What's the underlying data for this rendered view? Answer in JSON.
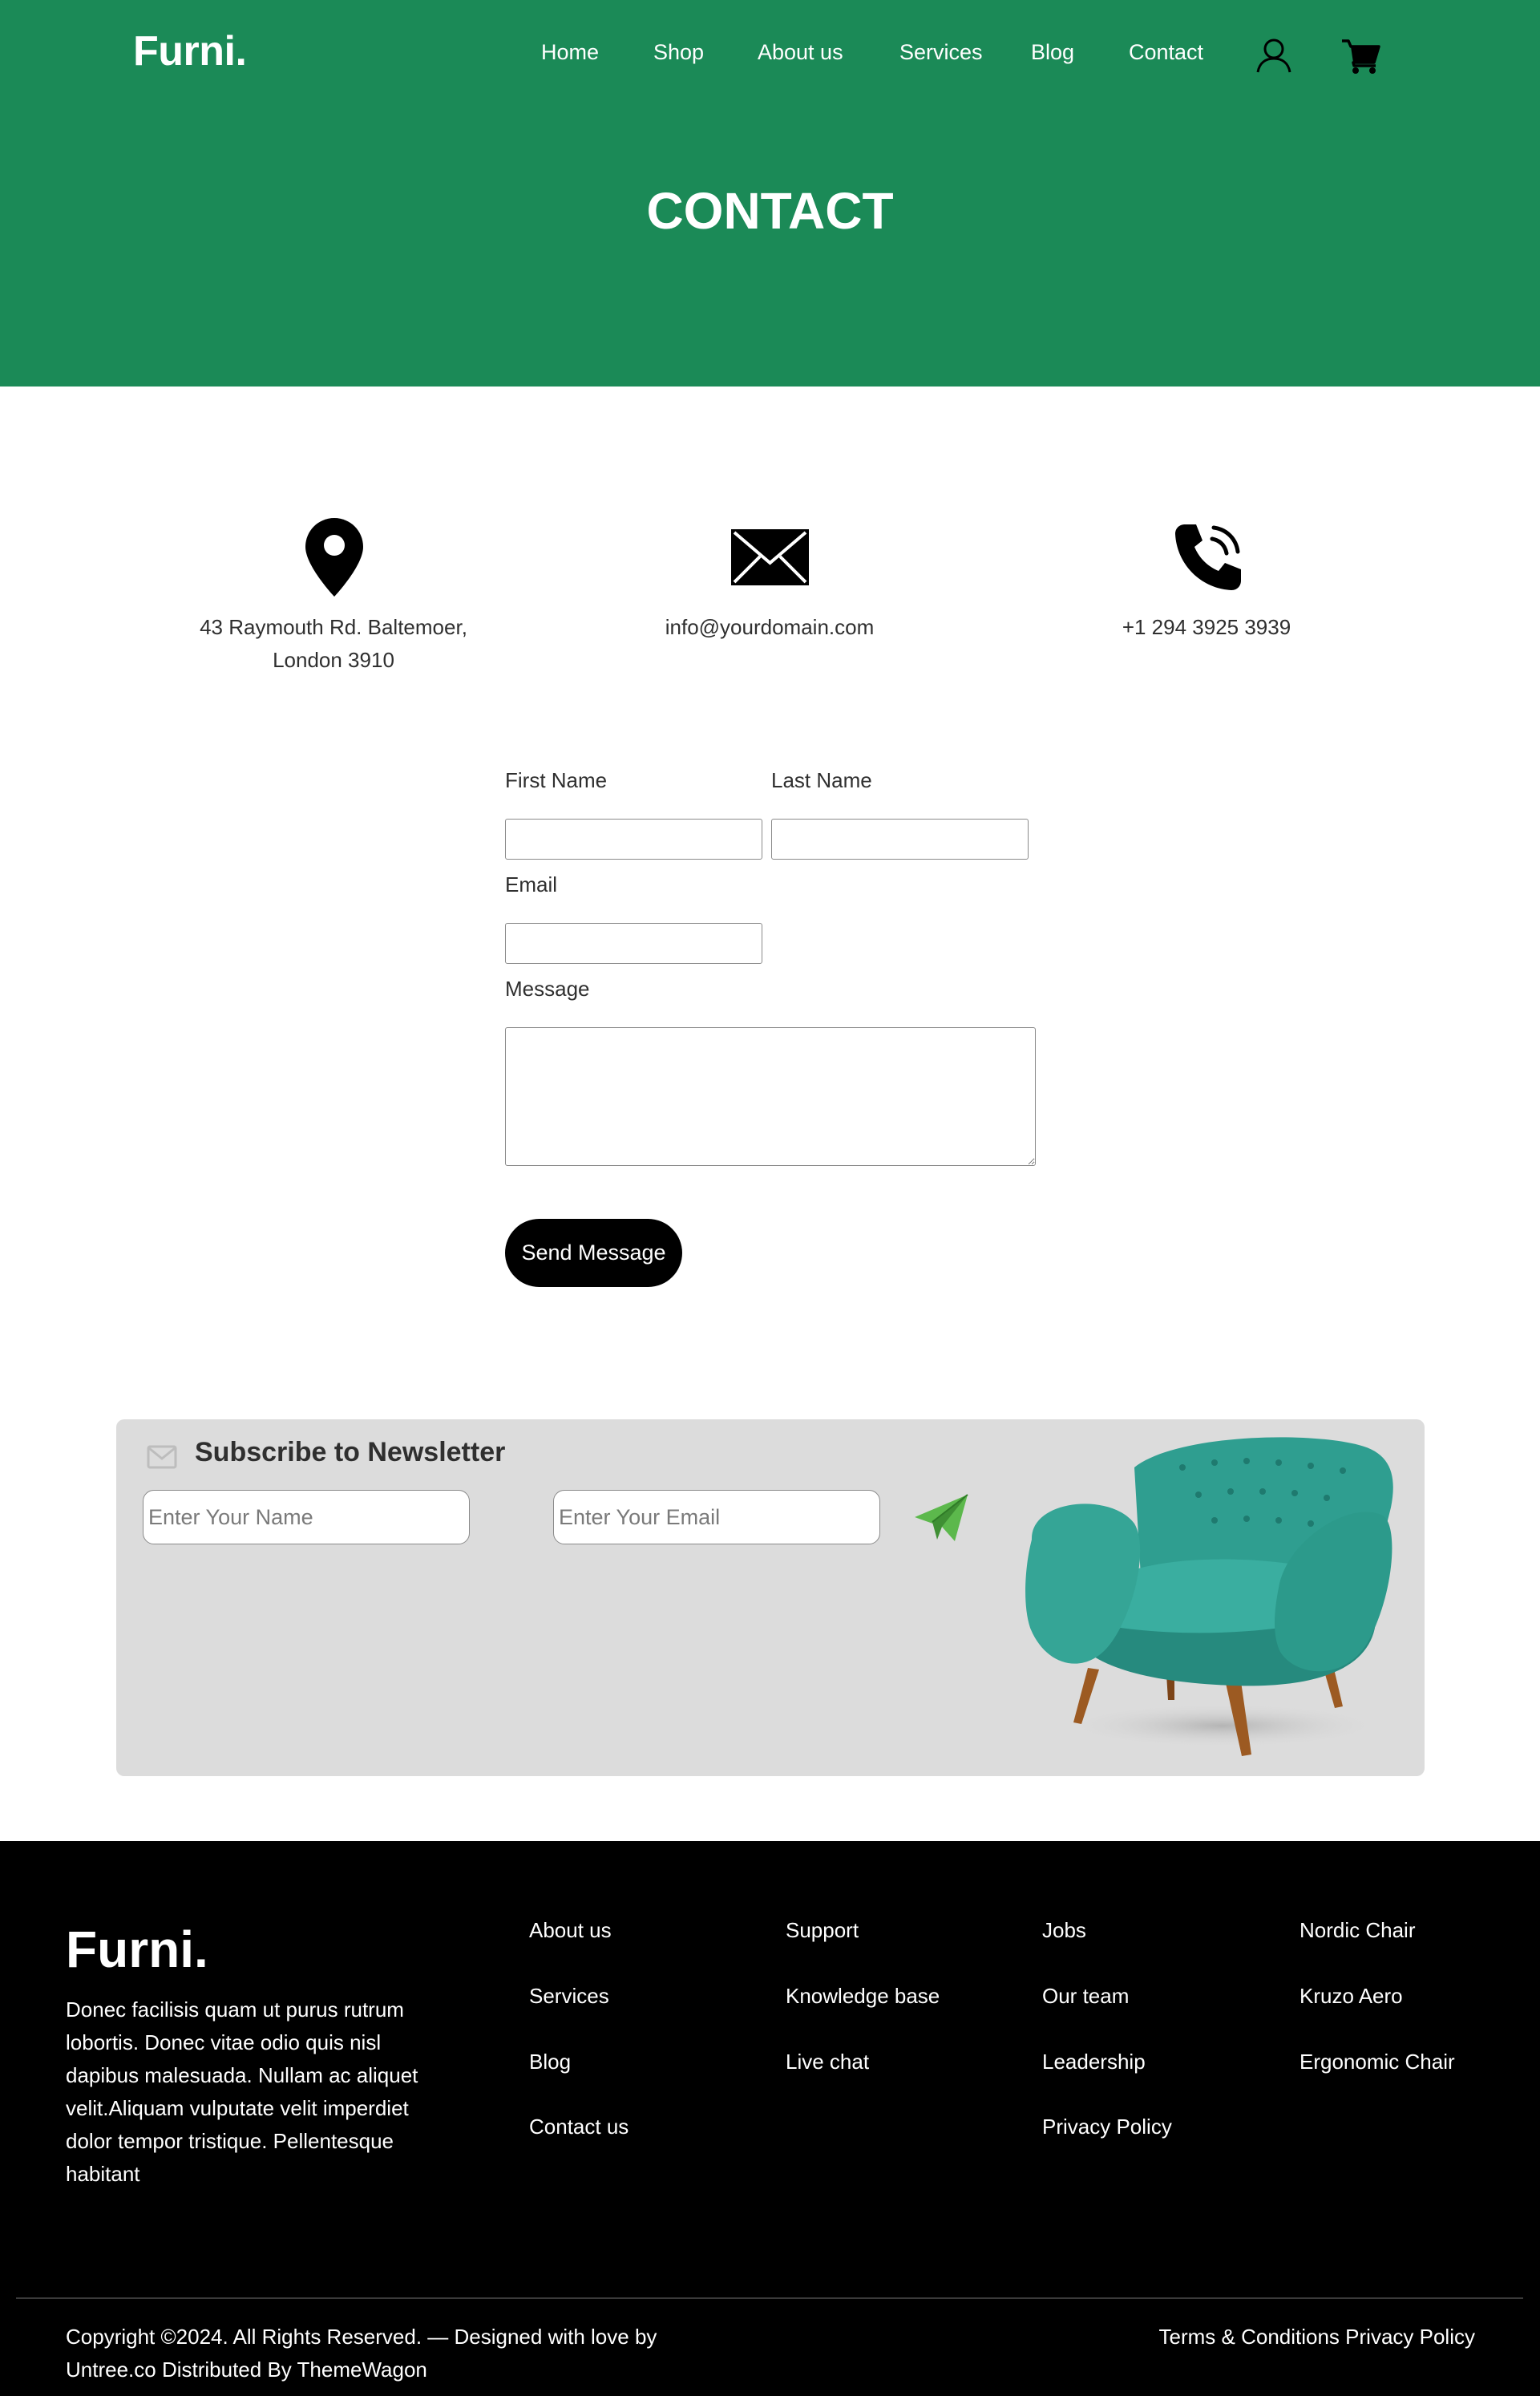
{
  "brand": {
    "name": "Furni."
  },
  "nav": {
    "items": [
      "Home",
      "Shop",
      "About us",
      "Services",
      "Blog",
      "Contact"
    ],
    "user_icon": "user-icon",
    "cart_icon": "cart-icon"
  },
  "hero": {
    "title": "CONTACT"
  },
  "contact_info": {
    "address_line1": "43 Raymouth Rd. Baltemoer,",
    "address_line2": "London 3910",
    "email": "info@yourdomain.com",
    "phone": "+1 294 3925 3939",
    "icons": [
      "map-pin-icon",
      "envelope-icon",
      "phone-icon"
    ]
  },
  "form": {
    "first_name_label": "First Name",
    "last_name_label": "Last Name",
    "email_label": "Email",
    "message_label": "Message",
    "first_name_value": "",
    "last_name_value": "",
    "email_value": "",
    "message_value": "",
    "submit_label": "Send Message"
  },
  "newsletter": {
    "title": "Subscribe to Newsletter",
    "name_placeholder": "Enter Your Name",
    "email_placeholder": "Enter Your Email",
    "icon": "envelope-icon",
    "send_icon": "paper-plane-icon",
    "image": "armchair-image"
  },
  "footer": {
    "brand": "Furni.",
    "description": "Donec facilisis quam ut purus rutrum lobortis. Donec vitae odio quis nisl dapibus malesuada. Nullam ac aliquet velit.Aliquam vulputate velit imperdiet dolor tempor tristique. Pellentesque habitant",
    "col1": [
      "About us",
      "Services",
      "Blog",
      "Contact us"
    ],
    "col2": [
      "Support",
      "Knowledge base",
      "Live chat"
    ],
    "col3": [
      "Jobs",
      "Our team",
      "Leadership",
      "Privacy Policy"
    ],
    "col4": [
      "Nordic Chair",
      "Kruzo Aero",
      "Ergonomic Chair"
    ],
    "copyright_line1": "Copyright ©2024. All Rights Reserved. — Designed with love by",
    "copyright_line2": "Untree.co Distributed By ThemeWagon",
    "terms": "Terms & Conditions",
    "privacy": "Privacy Policy"
  },
  "colors": {
    "primary_green": "#1b8a57",
    "button_black": "#000000",
    "newsletter_bg": "#dcdcdc",
    "chair_teal": "#2f9e90",
    "plane_green": "#4caf50"
  }
}
